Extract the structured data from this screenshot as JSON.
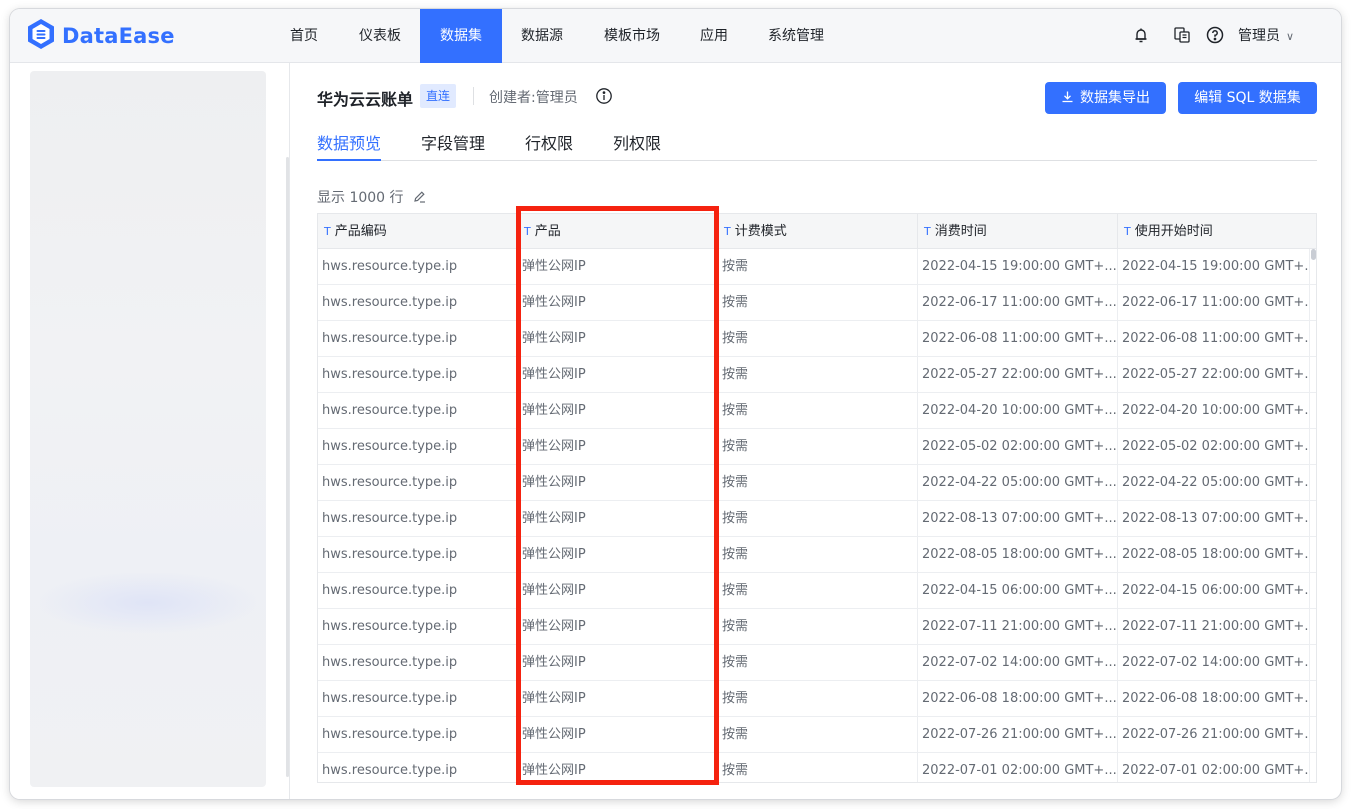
{
  "app": {
    "logo_text": "DataEase"
  },
  "nav": {
    "items": [
      {
        "label": "首页"
      },
      {
        "label": "仪表板"
      },
      {
        "label": "数据集"
      },
      {
        "label": "数据源"
      },
      {
        "label": "模板市场"
      },
      {
        "label": "应用"
      },
      {
        "label": "系统管理"
      }
    ],
    "active": "数据集",
    "user": "管理员"
  },
  "dataset": {
    "title": "华为云云账单",
    "badge": "直连",
    "creator": "创建者:管理员",
    "export_button": "数据集导出",
    "edit_button": "编辑 SQL 数据集"
  },
  "tabs": [
    {
      "label": "数据预览"
    },
    {
      "label": "字段管理"
    },
    {
      "label": "行权限"
    },
    {
      "label": "列权限"
    }
  ],
  "preview": {
    "row_count_text": "显示 1000 行"
  },
  "table": {
    "type_icon": "T",
    "columns": [
      "产品编码",
      "产品",
      "计费模式",
      "消费时间",
      "使用开始时间"
    ],
    "rows": [
      [
        "hws.resource.type.ip",
        "弹性公网IP",
        "按需",
        "2022-04-15 19:00:00 GMT+...",
        "2022-04-15 19:00:00 GMT+..."
      ],
      [
        "hws.resource.type.ip",
        "弹性公网IP",
        "按需",
        "2022-06-17 11:00:00 GMT+...",
        "2022-06-17 11:00:00 GMT+..."
      ],
      [
        "hws.resource.type.ip",
        "弹性公网IP",
        "按需",
        "2022-06-08 11:00:00 GMT+...",
        "2022-06-08 11:00:00 GMT+..."
      ],
      [
        "hws.resource.type.ip",
        "弹性公网IP",
        "按需",
        "2022-05-27 22:00:00 GMT+...",
        "2022-05-27 22:00:00 GMT+..."
      ],
      [
        "hws.resource.type.ip",
        "弹性公网IP",
        "按需",
        "2022-04-20 10:00:00 GMT+...",
        "2022-04-20 10:00:00 GMT+..."
      ],
      [
        "hws.resource.type.ip",
        "弹性公网IP",
        "按需",
        "2022-05-02 02:00:00 GMT+...",
        "2022-05-02 02:00:00 GMT+..."
      ],
      [
        "hws.resource.type.ip",
        "弹性公网IP",
        "按需",
        "2022-04-22 05:00:00 GMT+...",
        "2022-04-22 05:00:00 GMT+..."
      ],
      [
        "hws.resource.type.ip",
        "弹性公网IP",
        "按需",
        "2022-08-13 07:00:00 GMT+...",
        "2022-08-13 07:00:00 GMT+..."
      ],
      [
        "hws.resource.type.ip",
        "弹性公网IP",
        "按需",
        "2022-08-05 18:00:00 GMT+...",
        "2022-08-05 18:00:00 GMT+..."
      ],
      [
        "hws.resource.type.ip",
        "弹性公网IP",
        "按需",
        "2022-04-15 06:00:00 GMT+...",
        "2022-04-15 06:00:00 GMT+..."
      ],
      [
        "hws.resource.type.ip",
        "弹性公网IP",
        "按需",
        "2022-07-11 21:00:00 GMT+...",
        "2022-07-11 21:00:00 GMT+..."
      ],
      [
        "hws.resource.type.ip",
        "弹性公网IP",
        "按需",
        "2022-07-02 14:00:00 GMT+...",
        "2022-07-02 14:00:00 GMT+..."
      ],
      [
        "hws.resource.type.ip",
        "弹性公网IP",
        "按需",
        "2022-06-08 18:00:00 GMT+...",
        "2022-06-08 18:00:00 GMT+..."
      ],
      [
        "hws.resource.type.ip",
        "弹性公网IP",
        "按需",
        "2022-07-26 21:00:00 GMT+...",
        "2022-07-26 21:00:00 GMT+..."
      ],
      [
        "hws.resource.type.ip",
        "弹性公网IP",
        "按需",
        "2022-07-01 02:00:00 GMT+...",
        "2022-07-01 02:00:00 GMT+..."
      ]
    ]
  },
  "colors": {
    "accent": "#3370ff",
    "highlight_box": "#f5220f",
    "badge_bg": "#e1eaff"
  },
  "icons": {
    "logo": "dataease-logo-icon",
    "notification": "bell-icon",
    "template": "template-icon",
    "help": "help-circle-icon",
    "user_menu": "chevron-down-icon",
    "info": "info-circle-icon",
    "download": "download-icon",
    "edit": "edit-pencil-icon"
  }
}
